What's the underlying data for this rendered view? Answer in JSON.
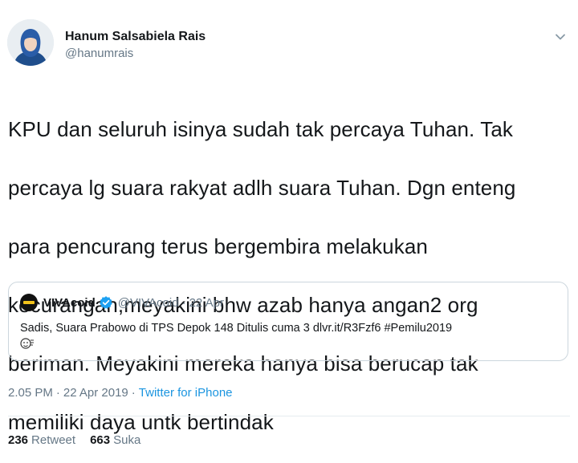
{
  "author": {
    "display_name": "Hanum Salsabiela Rais",
    "handle": "@hanumrais",
    "avatar_icon": "user-avatar-hijab"
  },
  "tweet": {
    "lines": [
      "KPU dan seluruh isinya sudah tak percaya Tuhan. Tak",
      "percaya lg suara rakyat adlh suara Tuhan. Dgn enteng",
      "para pencurang terus bergembira melakukan",
      "kecurangan,meyakini bhw azab hanya angan2 org",
      "beriman. Meyakini mereka hanya bisa berucap tak",
      "memiliki daya untk bertindak"
    ]
  },
  "quote": {
    "name": "VIVAcoid",
    "handle": "@VIVAcoid",
    "separator": "·",
    "date": "22 Apr",
    "text": "Sadis, Suara Prabowo di TPS Depok 148 Ditulis cuma 3 dlvr.it/R3Fzf6 #Pemilu2019",
    "verified_color": "#1da1f2"
  },
  "meta": {
    "time": "2.05 PM",
    "separator": "·",
    "date": "22 Apr 2019",
    "separator2": "·",
    "source": "Twitter for iPhone"
  },
  "stats": {
    "retweets_count": "236",
    "retweets_label": "Retweet",
    "likes_count": "663",
    "likes_label": "Suka"
  },
  "colors": {
    "text": "#14171a",
    "secondary": "#657786",
    "link": "#1b95e0",
    "border": "#ccd6dd"
  }
}
